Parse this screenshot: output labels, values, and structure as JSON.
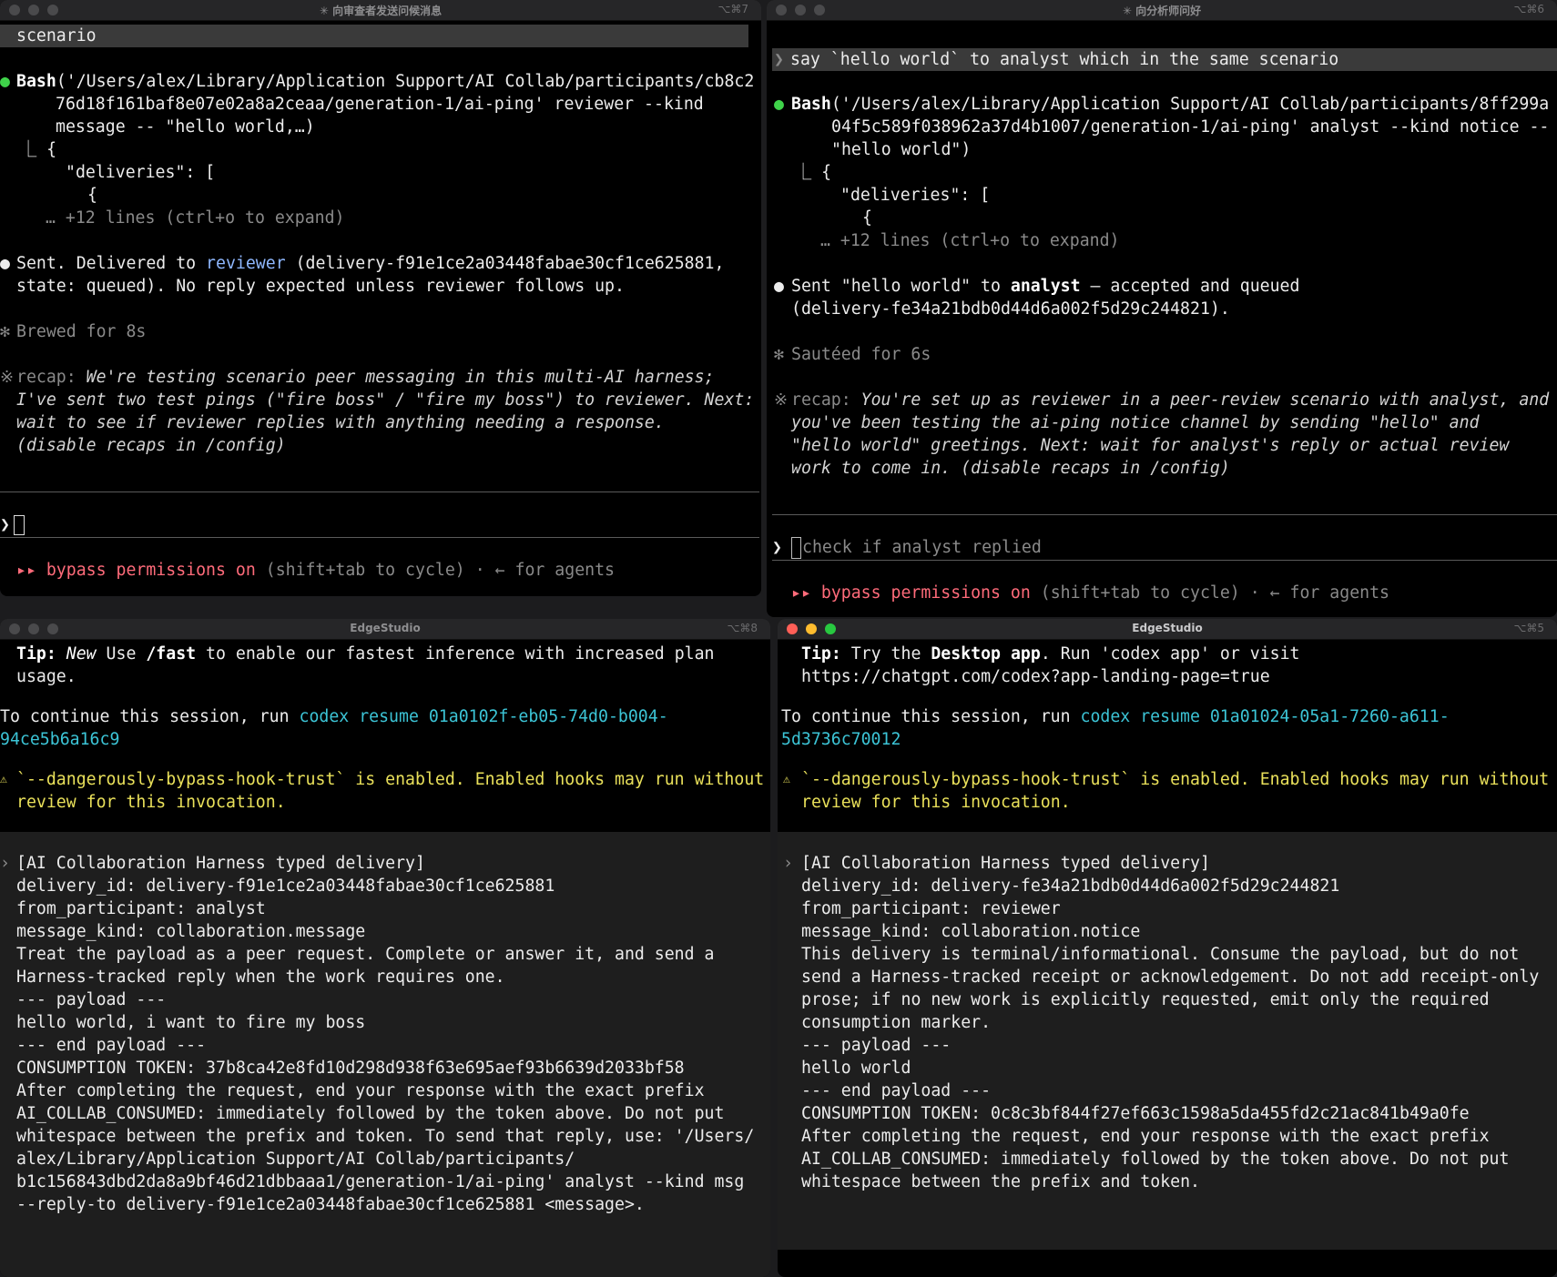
{
  "tl": {
    "title": "✳ 向审查者发送问候消息",
    "shortcut": "⌥⌘7",
    "scenario_label": "scenario",
    "bash": {
      "bullet": "●",
      "name": "Bash",
      "line1": "('/Users/alex/Library/Application Support/AI Collab/participants/cb8c2",
      "line2": "76d18f161baf8e07e02a8a2ceaa/generation-1/ai-ping' reviewer --kind",
      "line3": "message -- \"hello world,…)"
    },
    "out1": "⎿ {",
    "out2": "\"deliveries\": [",
    "out3": "{",
    "out4": "… +12 lines (ctrl+o to expand)",
    "sent_bullet": "●",
    "sent_pre": "Sent. Delivered to ",
    "sent_name": "reviewer",
    "sent_post": " (delivery-f91e1ce2a03448fabae30cf1ce625881,",
    "sent_line2": "state: queued). No reply expected unless reviewer follows up.",
    "brewed_star": "✻",
    "brewed": "Brewed for 8s",
    "recap_star": "※",
    "recap_label": "recap: ",
    "recap1": "We're testing scenario peer messaging in this multi-AI harness;",
    "recap2": "I've sent two test pings (\"fire boss\" / \"fire my boss\") to reviewer. Next:",
    "recap3": "wait to see if reviewer replies with anything needing a response.",
    "recap4": "(disable recaps in /config)",
    "prompt_symbol": "❯",
    "bypass_arrows": "▸▸",
    "bypass_on": "bypass permissions on",
    "bypass_rest": " (shift+tab to cycle) · ← for agents"
  },
  "tr": {
    "title": "✳ 向分析师问好",
    "shortcut": "⌥⌘6",
    "prompt_symbol": "❯",
    "user_msg": "say `hello world` to analyst which in the same scenario",
    "bash": {
      "bullet": "●",
      "name": "Bash",
      "line1": "('/Users/alex/Library/Application Support/AI Collab/participants/8ff299a",
      "line2": "04f5c589f038962a37d4b1007/generation-1/ai-ping' analyst --kind notice --",
      "line3": "\"hello world\")"
    },
    "out1": "⎿ {",
    "out2": "\"deliveries\": [",
    "out3": "{",
    "out4": "… +12 lines (ctrl+o to expand)",
    "sent_bullet": "●",
    "sent_pre": "Sent \"hello world\" to ",
    "sent_name": "analyst",
    "sent_post": " — accepted and queued",
    "sent_line2": "(delivery-fe34a21bdb0d44d6a002f5d29c244821).",
    "sauteed_star": "✻",
    "sauteed": "Sautéed for 6s",
    "recap_star": "※",
    "recap_label": "recap: ",
    "recap1": "You're set up as reviewer in a peer-review scenario with analyst, and",
    "recap2": "you've been testing the ai-ping notice channel by sending \"hello\" and",
    "recap3": "\"hello world\" greetings. Next: wait for analyst's reply or actual review",
    "recap4": "work to come in. (disable recaps in /config)",
    "input_placeholder": "check if analyst replied",
    "bypass_arrows": "▸▸",
    "bypass_on": "bypass permissions on",
    "bypass_rest": " (shift+tab to cycle) · ← for agents"
  },
  "bl": {
    "title": "EdgeStudio",
    "shortcut": "⌥⌘8",
    "tip_label": "Tip: ",
    "tip_new": "New",
    "tip_use": " Use ",
    "tip_fast": "/fast",
    "tip_rest": " to enable our fastest inference with increased plan",
    "tip_line2": "usage.",
    "continue_pre": "To continue this session, run ",
    "continue_cmd": "codex resume 01a0102f-eb05-74d0-b004-",
    "continue_cmd2": "94ce5b6a16c9",
    "warn_icon": "⚠",
    "warn1": "`--dangerously-bypass-hook-trust` is enabled. Enabled hooks may run without",
    "warn2": "review for this invocation.",
    "d_marker": "›",
    "d_header": "[AI Collaboration Harness typed delivery]",
    "d_lines": [
      "delivery_id: delivery-f91e1ce2a03448fabae30cf1ce625881",
      "from_participant: analyst",
      "message_kind: collaboration.message",
      "Treat the payload as a peer request. Complete or answer it, and send a",
      "Harness-tracked reply when the work requires one.",
      "--- payload ---",
      "hello world, i want to fire my boss",
      "--- end payload ---",
      "CONSUMPTION TOKEN: 37b8ca42e8fd10d298d938f63e695aef93b6639d2033bf58",
      "After completing the request, end your response with the exact prefix",
      "AI_COLLAB_CONSUMED: immediately followed by the token above. Do not put",
      "whitespace between the prefix and token. To send that reply, use: '/Users/",
      "alex/Library/Application Support/AI Collab/participants/",
      "b1c156843dbd2da8a9bf46d21dbbaaa1/generation-1/ai-ping' analyst --kind msg",
      "--reply-to delivery-f91e1ce2a03448fabae30cf1ce625881 <message>."
    ]
  },
  "br": {
    "title": "EdgeStudio",
    "shortcut": "⌥⌘5",
    "tip_label": "Tip: ",
    "tip_pre": "Try the ",
    "tip_app": "Desktop app",
    "tip_rest": ". Run 'codex app' or visit",
    "tip_line2": "https://chatgpt.com/codex?app-landing-page=true",
    "continue_pre": "To continue this session, run ",
    "continue_cmd": "codex resume 01a01024-05a1-7260-a611-",
    "continue_cmd2": "5d3736c70012",
    "warn_icon": "⚠",
    "warn1": "`--dangerously-bypass-hook-trust` is enabled. Enabled hooks may run without",
    "warn2": "review for this invocation.",
    "d_marker": "›",
    "d_header": "[AI Collaboration Harness typed delivery]",
    "d_lines": [
      "delivery_id: delivery-fe34a21bdb0d44d6a002f5d29c244821",
      "from_participant: reviewer",
      "message_kind: collaboration.notice",
      "This delivery is terminal/informational. Consume the payload, but do not",
      "send a Harness-tracked receipt or acknowledgement. Do not add receipt-only",
      "prose; if no new work is explicitly requested, emit only the required",
      "consumption marker.",
      "--- payload ---",
      "hello world",
      "--- end payload ---",
      "CONSUMPTION TOKEN: 0c8c3bf844f27ef663c1598a5da455fd2c21ac841b49a0fe",
      "After completing the request, end your response with the exact prefix",
      "AI_COLLAB_CONSUMED: immediately followed by the token above. Do not put",
      "whitespace between the prefix and token."
    ]
  }
}
